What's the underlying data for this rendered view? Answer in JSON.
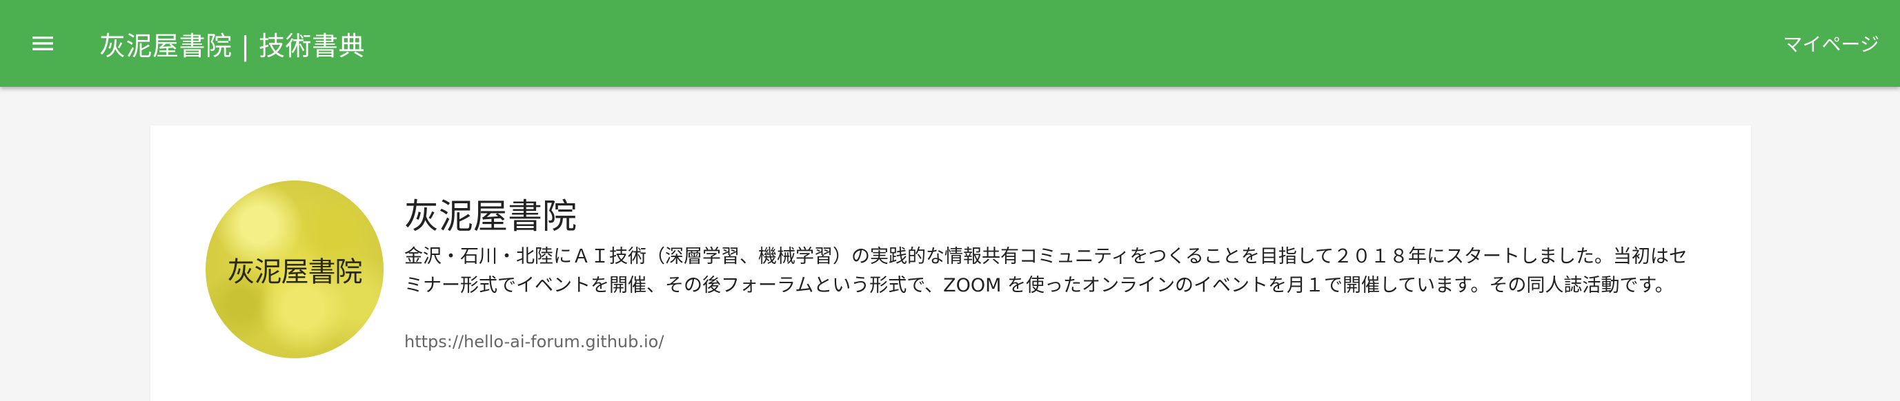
{
  "header": {
    "menu_icon": "hamburger-menu-icon",
    "title": "灰泥屋書院 | 技術書典",
    "mypage_label": "マイページ",
    "background_color": "#4caf50"
  },
  "publisher": {
    "avatar_text": "灰泥屋書院",
    "name": "灰泥屋書院",
    "description": "金沢・石川・北陸にＡＩ技術（深層学習、機械学習）の実践的な情報共有コミュニティをつくることを目指して２０１８年にスタートしました。当初はセミナー形式でイベントを開催、その後フォーラムという形式で、ZOOM を使ったオンラインのイベントを月１で開催しています。その同人誌活動です。",
    "url": "https://hello-ai-forum.github.io/"
  }
}
